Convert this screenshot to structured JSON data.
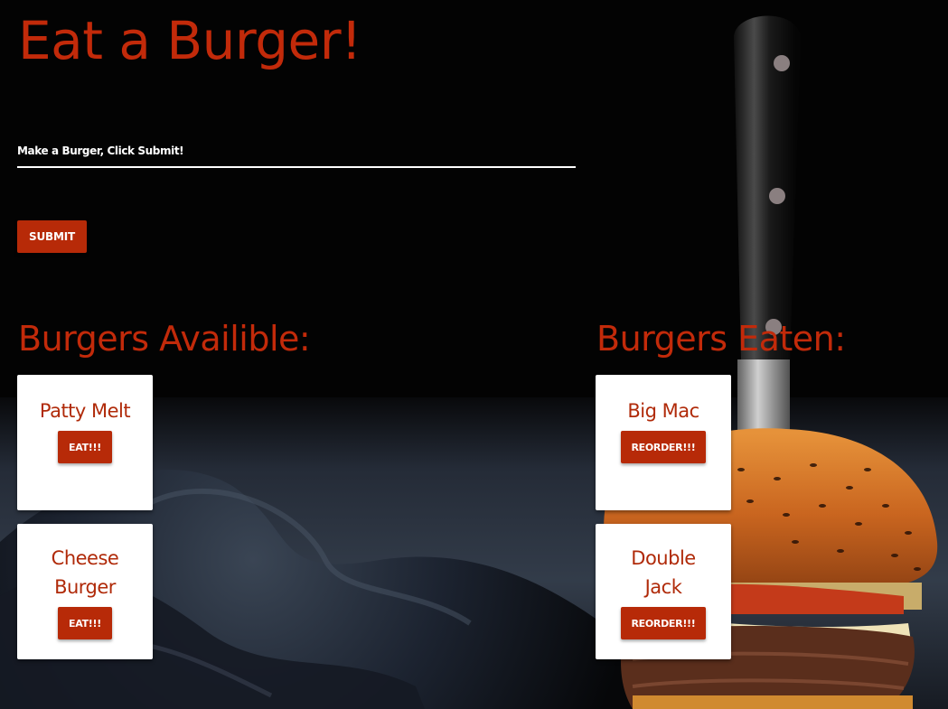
{
  "app": {
    "title": "Eat a Burger!"
  },
  "form": {
    "input_placeholder": "Make a Burger, Click Submit!",
    "input_value": "",
    "submit_label": "SUBMIT"
  },
  "available": {
    "heading": "Burgers Availible:",
    "burgers": [
      {
        "name": "Patty Melt",
        "button_label": "EAT!!!"
      },
      {
        "name": "Cheese Burger",
        "button_label": "EAT!!!"
      }
    ]
  },
  "eaten": {
    "heading": "Burgers Eaten:",
    "burgers": [
      {
        "name": "Big Mac",
        "button_label": "REORDER!!!"
      },
      {
        "name": "Double Jack",
        "button_label": "REORDER!!!"
      }
    ]
  },
  "colors": {
    "accent": "#b72a08",
    "heading": "#c22a0a",
    "background": "#030303",
    "card": "#ffffff"
  }
}
